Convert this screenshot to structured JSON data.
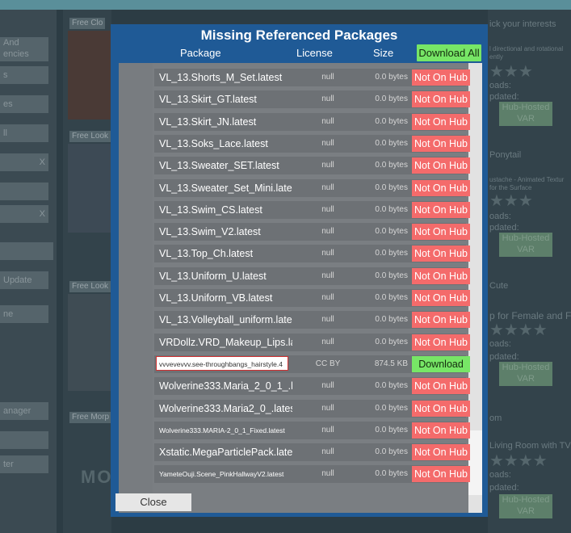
{
  "background": {
    "left_buttons": [
      "And\nencies",
      "s",
      "es",
      "ll",
      "X",
      "X",
      "",
      "Update",
      "ne",
      "anager",
      "",
      "ter"
    ],
    "tiles": [
      "Free Clo",
      "Free Look",
      "Free Look",
      "Free Morp"
    ],
    "right_texts": [
      "ick your interests",
      "l directional and rotational",
      "ently",
      "oads:",
      "pdated:",
      "Ponytail",
      "ustache - Animated Textur",
      "for the Surface",
      "oads:",
      "pdated:",
      "Cute",
      "p for Female and Fa",
      "oads:",
      "pdated:",
      "om",
      "Living Room with TV",
      "oads:",
      "pdated:"
    ],
    "right_buttons": [
      "Hub-Hosted\nVAR",
      "Hub-Hosted\nVAR",
      "Hub-Hosted\nVAR",
      "Hub-Hosted\nVAR"
    ],
    "bottom_logo": "MO"
  },
  "modal": {
    "title": "Missing Referenced Packages",
    "col_package": "Package",
    "col_license": "License",
    "col_size": "Size",
    "download_all_label": "Download All",
    "close_label": "Close",
    "rows": [
      {
        "name": "VL_13.Shorts_M_Set.latest",
        "license": "null",
        "size": "0.0 bytes",
        "action": "Not On Hub"
      },
      {
        "name": "VL_13.Skirt_GT.latest",
        "license": "null",
        "size": "0.0 bytes",
        "action": "Not On Hub"
      },
      {
        "name": "VL_13.Skirt_JN.latest",
        "license": "null",
        "size": "0.0 bytes",
        "action": "Not On Hub"
      },
      {
        "name": "VL_13.Soks_Lace.latest",
        "license": "null",
        "size": "0.0 bytes",
        "action": "Not On Hub"
      },
      {
        "name": "VL_13.Sweater_SET.latest",
        "license": "null",
        "size": "0.0 bytes",
        "action": "Not On Hub"
      },
      {
        "name": "VL_13.Sweater_Set_Mini.latest",
        "license": "null",
        "size": "0.0 bytes",
        "action": "Not On Hub"
      },
      {
        "name": "VL_13.Swim_CS.latest",
        "license": "null",
        "size": "0.0 bytes",
        "action": "Not On Hub"
      },
      {
        "name": "VL_13.Swim_V2.latest",
        "license": "null",
        "size": "0.0 bytes",
        "action": "Not On Hub"
      },
      {
        "name": "VL_13.Top_Ch.latest",
        "license": "null",
        "size": "0.0 bytes",
        "action": "Not On Hub"
      },
      {
        "name": "VL_13.Uniform_U.latest",
        "license": "null",
        "size": "0.0 bytes",
        "action": "Not On Hub"
      },
      {
        "name": "VL_13.Uniform_VB.latest",
        "license": "null",
        "size": "0.0 bytes",
        "action": "Not On Hub"
      },
      {
        "name": "VL_13.Volleyball_uniform.latest",
        "license": "null",
        "size": "0.0 bytes",
        "action": "Not On Hub"
      },
      {
        "name": "VRDollz.VRD_Makeup_Lips.latest",
        "license": "null",
        "size": "0.0 bytes",
        "action": "Not On Hub"
      },
      {
        "name": "vvvevevvv.see-throughbangs_hairstyle.4",
        "license": "CC BY",
        "size": "874.5 KB",
        "action": "Download"
      },
      {
        "name": "Wolverine333.Maria_2_0_1_.latest",
        "license": "null",
        "size": "0.0 bytes",
        "action": "Not On Hub"
      },
      {
        "name": "Wolverine333.Maria2_0_.latest",
        "license": "null",
        "size": "0.0 bytes",
        "action": "Not On Hub"
      },
      {
        "name": "Wolverine333.MARIA-2_0_1_Fixed.latest",
        "license": "null",
        "size": "0.0 bytes",
        "action": "Not On Hub"
      },
      {
        "name": "Xstatic.MegaParticlePack.latest",
        "license": "null",
        "size": "0.0 bytes",
        "action": "Not On Hub"
      },
      {
        "name": "YameteOuji.Scene_PinkHallwayV2.latest",
        "license": "null",
        "size": "0.0 bytes",
        "action": "Not On Hub"
      }
    ]
  },
  "colors": {
    "modal_bg": "#1f5a96",
    "not_on_hub": "#f46b6b",
    "download": "#77e666"
  }
}
